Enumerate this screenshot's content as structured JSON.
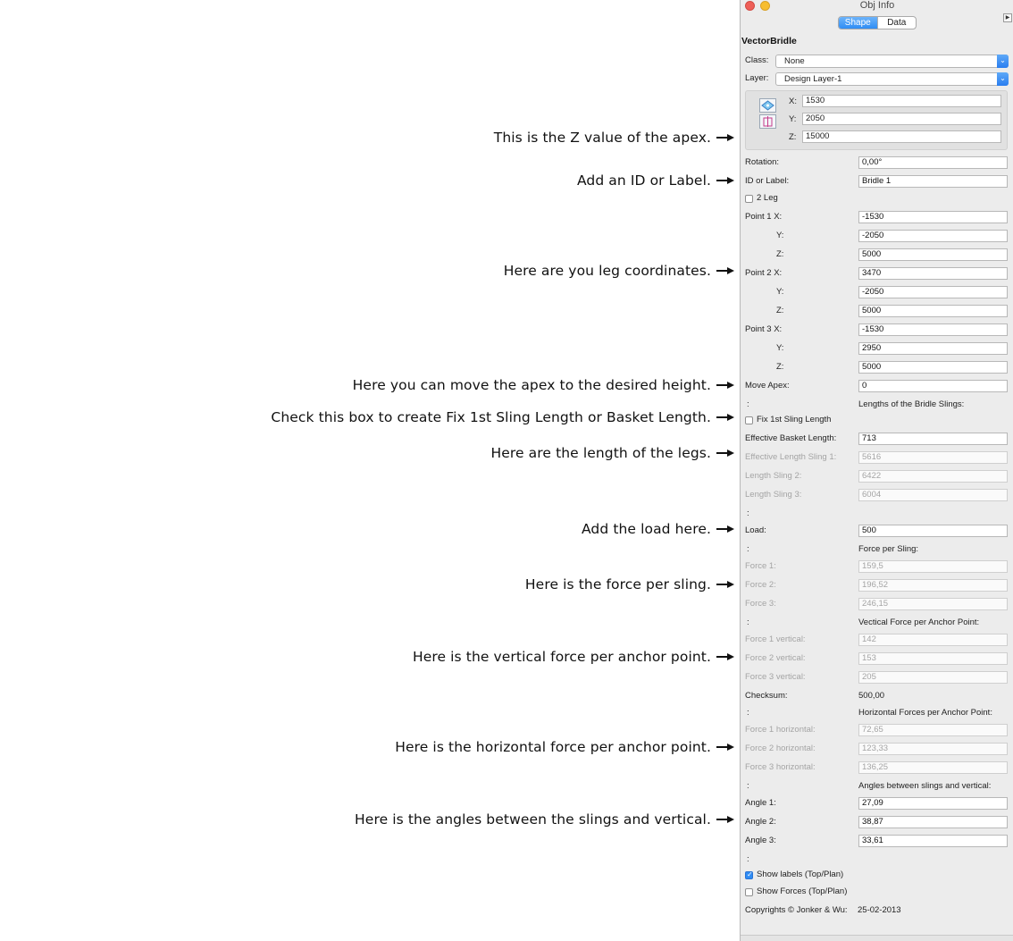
{
  "annotations": [
    "This is the Z value of the apex.",
    "Add an ID or Label.",
    "Here are you leg coordinates.",
    "Here you can move the apex to the desired height.",
    "Check this box to create Fix 1st Sling Length or Basket Length.",
    "Here are the length of the legs.",
    "Add the load here.",
    "Here is the force per sling.",
    "Here is the vertical force per anchor point.",
    "Here is the horizontal force per anchor point.",
    "Here is the angles between the slings and vertical."
  ],
  "window": {
    "title": "Obj Info",
    "tabs": [
      "Shape",
      "Data"
    ],
    "active_tab": "Shape",
    "object_name": "VectorBridle"
  },
  "class": {
    "label": "Class:",
    "value": "None"
  },
  "layer": {
    "label": "Layer:",
    "value": "Design Layer-1"
  },
  "coords": {
    "x_label": "X:",
    "x": "1530",
    "y_label": "Y:",
    "y": "2050",
    "z_label": "Z:",
    "z": "15000"
  },
  "fields": {
    "rotation": {
      "label": "Rotation:",
      "value": "0,00°"
    },
    "id_label": {
      "label": "ID or Label:",
      "value": "Bridle 1"
    },
    "two_leg": {
      "label": "2 Leg",
      "checked": false
    },
    "p1x": {
      "label": "Point 1 X:",
      "value": "-1530"
    },
    "p1y": {
      "label": "Y:",
      "value": "-2050"
    },
    "p1z": {
      "label": "Z:",
      "value": "5000"
    },
    "p2x": {
      "label": "Point 2 X:",
      "value": "3470"
    },
    "p2y": {
      "label": "Y:",
      "value": "-2050"
    },
    "p2z": {
      "label": "Z:",
      "value": "5000"
    },
    "p3x": {
      "label": "Point 3 X:",
      "value": "-1530"
    },
    "p3y": {
      "label": "Y:",
      "value": "2950"
    },
    "p3z": {
      "label": "Z:",
      "value": "5000"
    },
    "move_apex": {
      "label": "Move Apex:",
      "value": "0"
    },
    "sep1": {
      "label": ":",
      "text": "Lengths of the Bridle Slings:"
    },
    "fix_first": {
      "label": "Fix 1st Sling Length",
      "checked": false
    },
    "basket": {
      "label": "Effective Basket Length:",
      "value": "713"
    },
    "len1": {
      "label": "Effective Length Sling 1:",
      "value": "5616"
    },
    "len2": {
      "label": "Length Sling 2:",
      "value": "6422"
    },
    "len3": {
      "label": "Length Sling 3:",
      "value": "6004"
    },
    "sep2": {
      "label": ":"
    },
    "load": {
      "label": "Load:",
      "value": "500"
    },
    "sep3": {
      "label": ":",
      "text": "Force per Sling:"
    },
    "force1": {
      "label": "Force 1:",
      "value": "159,5"
    },
    "force2": {
      "label": "Force 2:",
      "value": "196,52"
    },
    "force3": {
      "label": "Force 3:",
      "value": "246,15"
    },
    "sep4": {
      "label": ":",
      "text": "Vectical Force per Anchor Point:"
    },
    "fv1": {
      "label": "Force 1 vertical:",
      "value": "142"
    },
    "fv2": {
      "label": "Force 2 vertical:",
      "value": "153"
    },
    "fv3": {
      "label": "Force 3 vertical:",
      "value": "205"
    },
    "checksum": {
      "label": "Checksum:",
      "value": "500,00"
    },
    "sep5": {
      "label": ":",
      "text": "Horizontal Forces per Anchor Point:"
    },
    "fh1": {
      "label": "Force 1 horizontal:",
      "value": "72,65"
    },
    "fh2": {
      "label": "Force 2 horizontal:",
      "value": "123,33"
    },
    "fh3": {
      "label": "Force 3 horizontal:",
      "value": "136,25"
    },
    "sep6": {
      "label": ":",
      "text": "Angles between slings and vertical:"
    },
    "angle1": {
      "label": "Angle 1:",
      "value": "27,09"
    },
    "angle2": {
      "label": "Angle 2:",
      "value": "38,87"
    },
    "angle3": {
      "label": "Angle 3:",
      "value": "33,61"
    },
    "sep7": {
      "label": ":"
    },
    "show_labels": {
      "label": "Show labels (Top/Plan)",
      "checked": true
    },
    "show_forces": {
      "label": "Show Forces (Top/Plan)",
      "checked": false
    },
    "copyright": {
      "label": "Copyrights © Jonker & Wu:",
      "value": "25-02-2013"
    }
  },
  "colors": {
    "accent": "#2f8cf4",
    "panel_bg": "#ececec",
    "disabled_text": "#a4a4a4"
  }
}
